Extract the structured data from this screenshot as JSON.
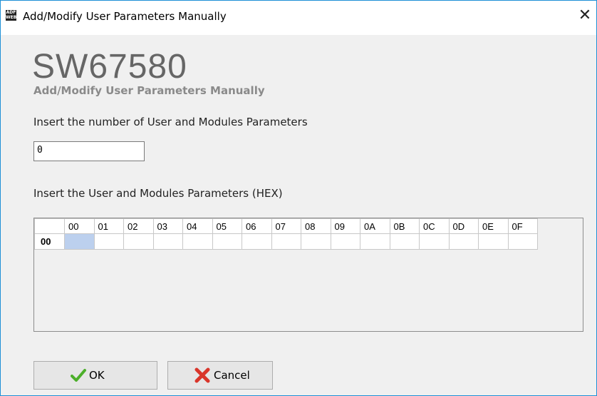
{
  "window": {
    "title": "Add/Modify User Parameters Manually",
    "app_icon_text": "ADF web",
    "close_glyph": "✕"
  },
  "header": {
    "product": "SW67580",
    "subtitle": "Add/Modify User Parameters Manually"
  },
  "form": {
    "count_label": "Insert the number of User and Modules Parameters",
    "count_value": "0",
    "params_label": "Insert the User and Modules Parameters (HEX)"
  },
  "grid": {
    "columns": [
      "00",
      "01",
      "02",
      "03",
      "04",
      "05",
      "06",
      "07",
      "08",
      "09",
      "0A",
      "0B",
      "0C",
      "0D",
      "0E",
      "0F"
    ],
    "rows": [
      "00"
    ],
    "selected_cell": {
      "row": "00",
      "column": "00"
    }
  },
  "buttons": {
    "ok_label": "OK",
    "cancel_label": "Cancel"
  },
  "icons": {
    "app": "adfweb-logo-icon",
    "ok": "checkmark-icon",
    "cancel": "x-cross-icon"
  },
  "colors": {
    "accent_border": "#1e90d6",
    "selected_cell": "#bcd0ee",
    "check_green": "#4caf2a",
    "cancel_red": "#d9352a"
  }
}
